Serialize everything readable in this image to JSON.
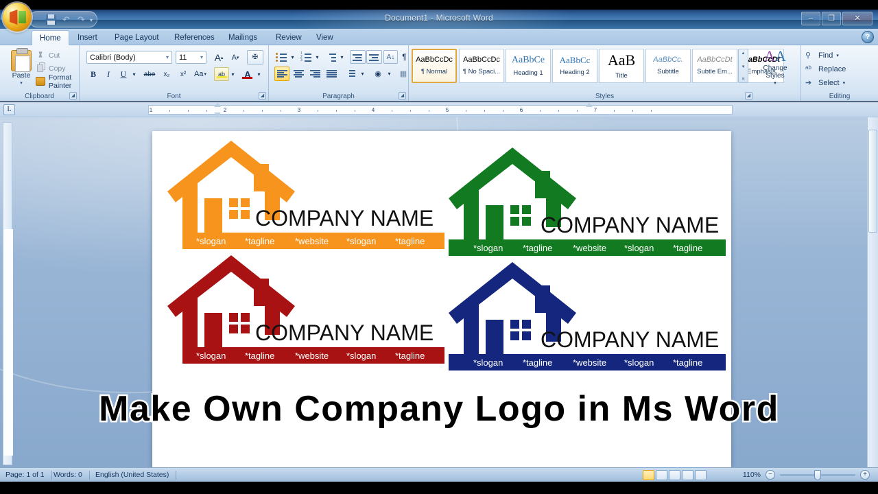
{
  "window": {
    "title": "Document1 - Microsoft Word",
    "minimize": "–",
    "restore": "❐",
    "close": "✕",
    "help": "?"
  },
  "quick_access": {
    "save": "save-icon",
    "undo": "undo-icon",
    "redo": "redo-icon",
    "customize": "▾"
  },
  "ribbon": {
    "tabs": [
      {
        "label": "Home",
        "active": true
      },
      {
        "label": "Insert",
        "active": false
      },
      {
        "label": "Page Layout",
        "active": false
      },
      {
        "label": "References",
        "active": false
      },
      {
        "label": "Mailings",
        "active": false
      },
      {
        "label": "Review",
        "active": false
      },
      {
        "label": "View",
        "active": false
      }
    ],
    "clipboard": {
      "group_label": "Clipboard",
      "paste": "Paste",
      "paste_arrow": "▾",
      "cut": "Cut",
      "copy": "Copy",
      "format_painter": "Format Painter"
    },
    "font": {
      "group_label": "Font",
      "font_name": "Calibri (Body)",
      "font_size": "11",
      "grow_font": "A",
      "shrink_font": "A",
      "clear_formatting": "clear-formatting-icon",
      "bold": "B",
      "italic": "I",
      "underline": "U",
      "strikethrough": "abe",
      "subscript": "x₂",
      "superscript": "x²",
      "change_case": "Aa",
      "highlight": "ab",
      "font_color": "A",
      "dropdown": "▾"
    },
    "paragraph": {
      "group_label": "Paragraph",
      "bullets": "bullets-icon",
      "numbering": "numbering-icon",
      "multilevel": "multilevel-list-icon",
      "decrease_indent": "decrease-indent-icon",
      "increase_indent": "increase-indent-icon",
      "sort": "sort-icon",
      "show_marks": "¶",
      "align_left": "align-left-icon",
      "align_center": "align-center-icon",
      "align_right": "align-right-icon",
      "justify": "justify-icon",
      "line_spacing": "line-spacing-icon",
      "shading": "shading-icon",
      "borders": "borders-icon"
    },
    "styles": {
      "group_label": "Styles",
      "items": [
        {
          "sample": "AaBbCcDc",
          "name": "¶ Normal",
          "selected": true
        },
        {
          "sample": "AaBbCcDc",
          "name": "¶ No Spaci...",
          "selected": false
        },
        {
          "sample": "AaBbCе",
          "name": "Heading 1",
          "selected": false
        },
        {
          "sample": "AaBbCc",
          "name": "Heading 2",
          "selected": false
        },
        {
          "sample": "AaB",
          "name": "Title",
          "selected": false
        },
        {
          "sample": "AaBbCc.",
          "name": "Subtitle",
          "selected": false
        },
        {
          "sample": "AaBbCcDt",
          "name": "Subtle Em...",
          "selected": false
        },
        {
          "sample": "AaBbCcDt",
          "name": "Emphasis",
          "selected": false
        }
      ],
      "change_styles": "Change Styles",
      "scroll_up": "▴",
      "scroll_down": "▾",
      "scroll_more": "≡"
    },
    "editing": {
      "group_label": "Editing",
      "find": "Find",
      "replace": "Replace",
      "select": "Select",
      "dropdown": "▾"
    }
  },
  "ruler": {
    "tab_selector": "L",
    "marks": [
      "1",
      "2",
      "3",
      "4",
      "5",
      "6",
      "7"
    ]
  },
  "document": {
    "logos": [
      {
        "color": "#F7941E",
        "bar_color": "#F7941E",
        "company_name": "COMPANY NAME",
        "taglines": [
          "*slogan",
          "*tagline",
          "*website",
          "*slogan",
          "*tagline"
        ],
        "tagline_color": "#FFFFFF"
      },
      {
        "color": "#127B22",
        "bar_color": "#127B22",
        "company_name": "COMPANY NAME",
        "taglines": [
          "*slogan",
          "*tagline",
          "*website",
          "*slogan",
          "*tagline"
        ],
        "tagline_color": "#FFFFFF"
      },
      {
        "color": "#A81212",
        "bar_color": "#A81212",
        "company_name": "COMPANY NAME",
        "taglines": [
          "*slogan",
          "*tagline",
          "*website",
          "*slogan",
          "*tagline"
        ],
        "tagline_color": "#FFFFFF"
      },
      {
        "color": "#15267E",
        "bar_color": "#15267E",
        "company_name": "COMPANY NAME",
        "taglines": [
          "*slogan",
          "*tagline",
          "*website",
          "*slogan",
          "*tagline"
        ],
        "tagline_color": "#FFFFFF"
      }
    ],
    "caption": "Make Own Company Logo in Ms Word"
  },
  "status_bar": {
    "page": "Page: 1 of 1",
    "words": "Words: 0",
    "language": "English (United States)",
    "zoom_percent": "110%",
    "zoom_out": "−",
    "zoom_in": "+",
    "views": [
      "print-layout-view",
      "full-screen-reading-view",
      "web-layout-view",
      "outline-view",
      "draft-view"
    ]
  }
}
